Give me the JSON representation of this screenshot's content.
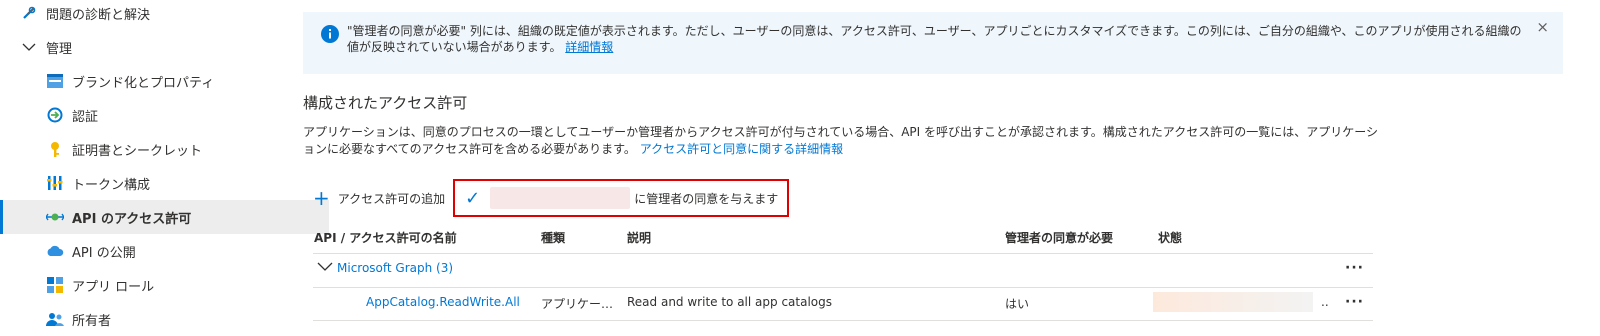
{
  "sidebar": {
    "items": [
      {
        "label": "問題の診断と解決"
      },
      {
        "label": "管理"
      },
      {
        "label": "ブランド化とプロパティ"
      },
      {
        "label": "認証"
      },
      {
        "label": "証明書とシークレット"
      },
      {
        "label": "トークン構成"
      },
      {
        "label": "API のアクセス許可"
      },
      {
        "label": "API の公開"
      },
      {
        "label": "アプリ ロール"
      },
      {
        "label": "所有者"
      }
    ]
  },
  "banner": {
    "message": "\"管理者の同意が必要\" 列には、組織の既定値が表示されます。ただし、ユーザーの同意は、アクセス許可、ユーザー、アプリごとにカスタマイズできます。この列には、ご自分の組織や、このアプリが使用される組織の値が反映されていない場合があります。",
    "link": "詳細情報",
    "close": "×"
  },
  "section": {
    "title": "構成されたアクセス許可",
    "description": "アプリケーションは、同意のプロセスの一環としてユーザーか管理者からアクセス許可が付与されている場合、API を呼び出すことが承認されます。構成されたアクセス許可の一覧には、アプリケーションに必要なすべてのアクセス許可を含める必要があります。",
    "link": "アクセス許可と同意に関する詳細情報"
  },
  "toolbar": {
    "add_label": "アクセス許可の追加",
    "grant_label": "に管理者の同意を与えます"
  },
  "table": {
    "headers": [
      "API / アクセス許可の名前",
      "種類",
      "説明",
      "管理者の同意が必要",
      "状態"
    ],
    "group": {
      "label": "Microsoft Graph (3)"
    },
    "rows": [
      {
        "name": "AppCatalog.ReadWrite.All",
        "type": "アプリケー…",
        "description": "Read and write to all app catalogs",
        "admin_consent": "はい",
        "status_trail": ".."
      }
    ],
    "more": "···"
  },
  "colors": {
    "accent": "#0078d4",
    "highlight": "#e00000",
    "banner_bg": "#eff6fc"
  }
}
